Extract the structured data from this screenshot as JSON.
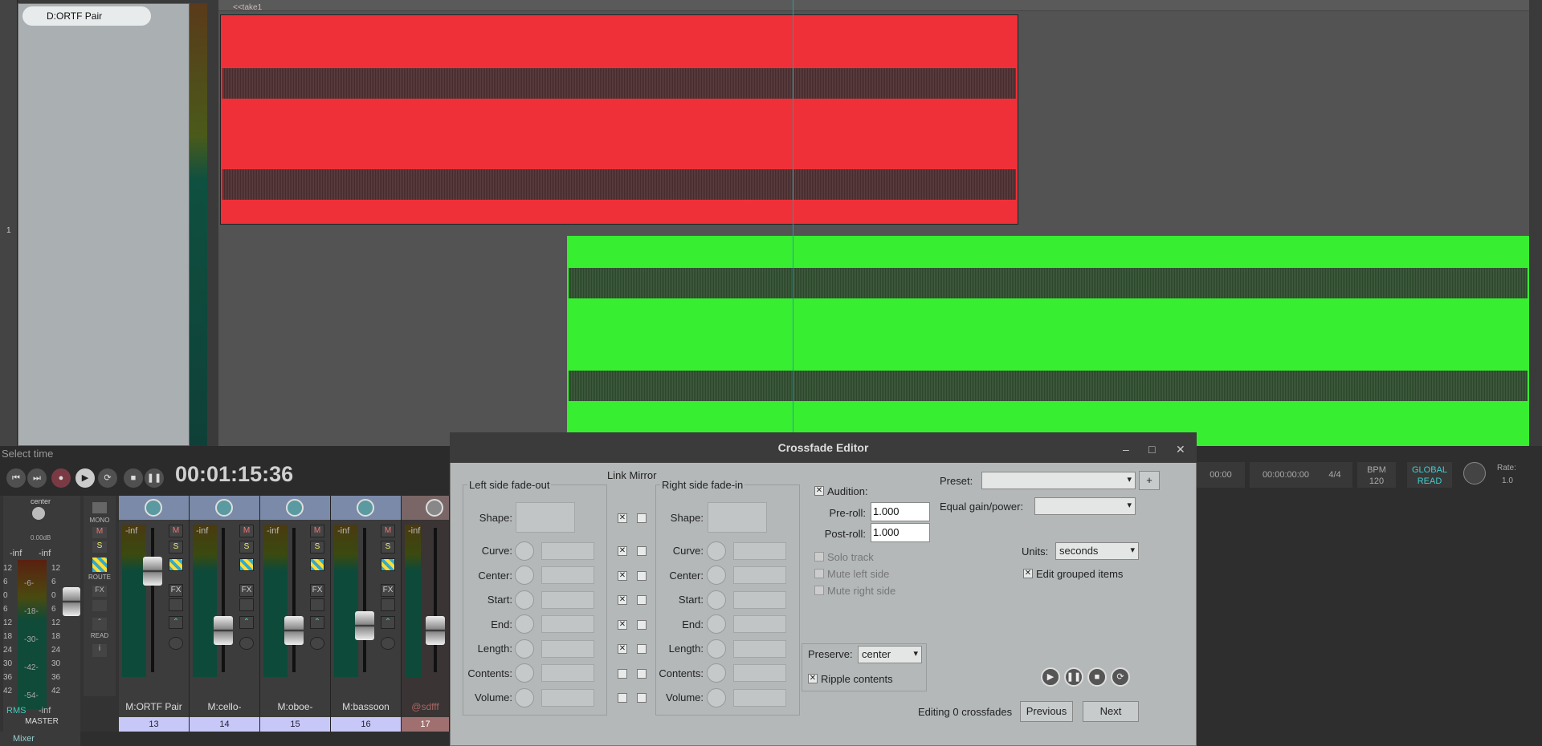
{
  "track": {
    "name": "D:ORTF Pair",
    "number": "1"
  },
  "take_label": "<<take1",
  "transport": {
    "select_time": "Select time",
    "timecode": "00:01:15:36"
  },
  "right_bar": {
    "time1": "00:00",
    "time2": "00:00:00:00",
    "signature": "4/4",
    "bpm_label": "BPM",
    "bpm": "120",
    "global": "GLOBAL",
    "read": "READ",
    "rate_label": "Rate:",
    "rate": "1.0"
  },
  "master": {
    "pan": "center",
    "db": "0.00dB",
    "inf_l": "-inf",
    "inf_r": "-inf",
    "mono": "MONO",
    "route": "ROUTE",
    "read": "READ",
    "rms": "RMS",
    "rms_val": "-inf",
    "label": "MASTER",
    "scale": [
      "12",
      "6",
      "0",
      "6",
      "12",
      "18",
      "24",
      "30",
      "36",
      "42"
    ],
    "scale_mid": [
      "-6-",
      "-18-",
      "-30-",
      "-42-",
      "-54-"
    ]
  },
  "strips": [
    {
      "name": "M:ORTF Pair",
      "num": "13",
      "inf": "-inf",
      "m": "M",
      "s": "S",
      "fx": "FX"
    },
    {
      "name": "M:cello-",
      "num": "14",
      "inf": "-inf",
      "m": "M",
      "s": "S",
      "fx": "FX"
    },
    {
      "name": "M:oboe-",
      "num": "15",
      "inf": "-inf",
      "m": "M",
      "s": "S",
      "fx": "FX"
    },
    {
      "name": "M:bassoon",
      "num": "16",
      "inf": "-inf",
      "m": "M",
      "s": "S",
      "fx": "FX"
    },
    {
      "name": "@sdfff",
      "num": "17",
      "inf": "-inf"
    }
  ],
  "mixer_tab": "Mixer",
  "dialog": {
    "title": "Crossfade Editor",
    "link": "Link",
    "mirror": "Mirror",
    "left_group": "Left side fade-out",
    "right_group": "Right side fade-in",
    "rows": [
      "Shape:",
      "Curve:",
      "Center:",
      "Start:",
      "End:",
      "Length:",
      "Contents:",
      "Volume:"
    ],
    "audition": "Audition:",
    "preroll_label": "Pre-roll:",
    "preroll": "1.000",
    "postroll_label": "Post-roll:",
    "postroll": "1.000",
    "solo_track": "Solo track",
    "mute_left": "Mute left side",
    "mute_right": "Mute right side",
    "preset_label": "Preset:",
    "preset_value": "",
    "plus": "+",
    "equal_gain_label": "Equal gain/power:",
    "equal_gain_value": "",
    "units_label": "Units:",
    "units_value": "seconds",
    "edit_grouped": "Edit grouped items",
    "preserve_label": "Preserve:",
    "preserve_value": "center",
    "ripple": "Ripple contents",
    "status": "Editing 0 crossfades",
    "previous": "Previous",
    "next": "Next"
  }
}
